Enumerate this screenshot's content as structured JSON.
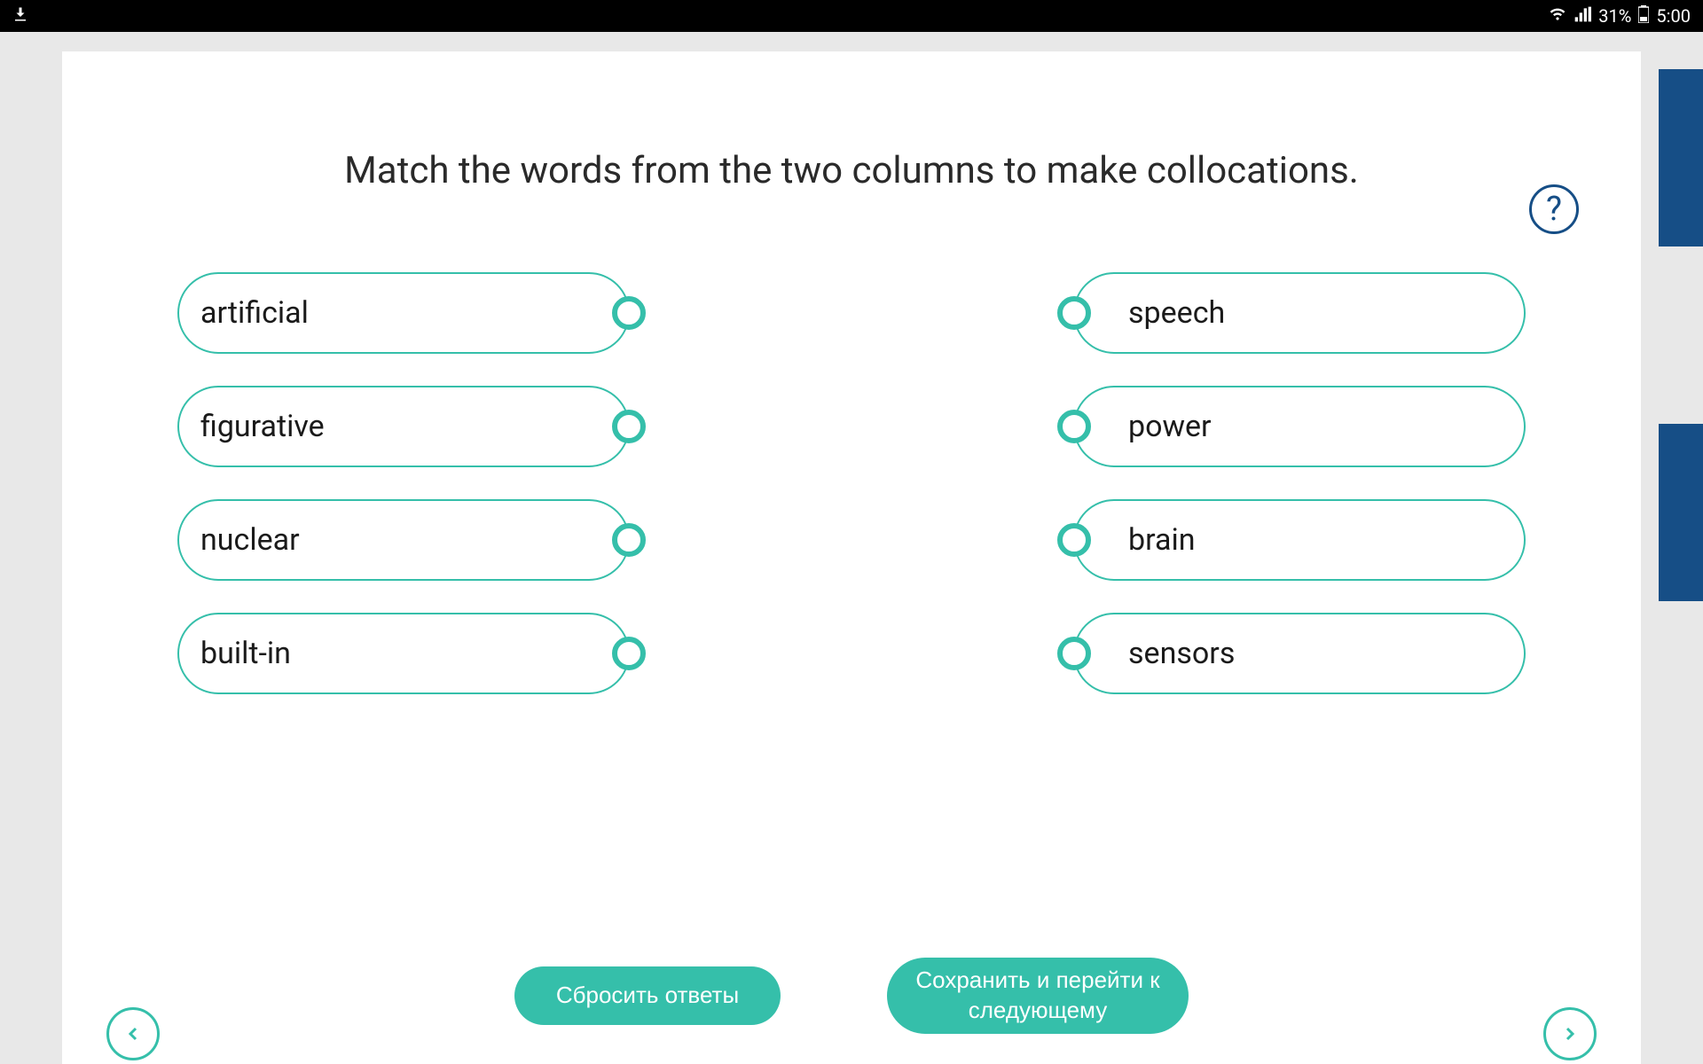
{
  "statusBar": {
    "battery": "31%",
    "time": "5:00"
  },
  "instruction": "Match the words from the two columns to make collocations.",
  "helpIcon": "?",
  "leftColumn": [
    "artificial",
    "figurative",
    "nuclear",
    "built-in"
  ],
  "rightColumn": [
    "speech",
    "power",
    "brain",
    "sensors"
  ],
  "buttons": {
    "reset": "Сбросить ответы",
    "next": "Сохранить и перейти к следующему"
  }
}
